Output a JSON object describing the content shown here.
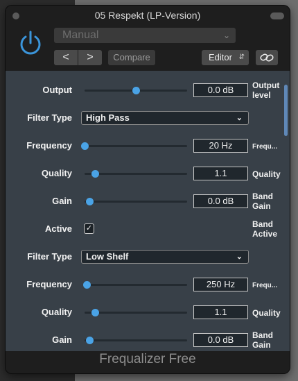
{
  "window": {
    "title": "05 Respekt (LP-Version)"
  },
  "header": {
    "preset": "Manual",
    "nav_prev": "<",
    "nav_next": ">",
    "compare": "Compare",
    "editor": "Editor"
  },
  "colors": {
    "accent": "#4aa3e6",
    "panel": "#384048"
  },
  "rows": [
    {
      "kind": "slider",
      "label": "Output",
      "value": "0.0 dB",
      "unit": "Output level",
      "unit_lines": [
        "Output",
        "level"
      ],
      "level": 0.5
    },
    {
      "kind": "select",
      "label": "Filter Type",
      "value": "High Pass"
    },
    {
      "kind": "slider",
      "label": "Frequency",
      "value": "20 Hz",
      "unit_lines": [
        "Frequ..."
      ],
      "level": 0.0
    },
    {
      "kind": "slider",
      "label": "Quality",
      "value": "1.1",
      "unit_lines": [
        "Quality"
      ],
      "level": 0.1
    },
    {
      "kind": "slider",
      "label": "Gain",
      "value": "0.0 dB",
      "unit_lines": [
        "Band",
        "Gain"
      ],
      "level": 0.05
    },
    {
      "kind": "check",
      "label": "Active",
      "checked": true,
      "unit_lines": [
        "Band",
        "Active"
      ]
    },
    {
      "kind": "select",
      "label": "Filter Type",
      "value": "Low Shelf"
    },
    {
      "kind": "slider",
      "label": "Frequency",
      "value": "250 Hz",
      "unit_lines": [
        "Frequ..."
      ],
      "level": 0.02
    },
    {
      "kind": "slider",
      "label": "Quality",
      "value": "1.1",
      "unit_lines": [
        "Quality"
      ],
      "level": 0.1
    },
    {
      "kind": "slider",
      "label": "Gain",
      "value": "0.0 dB",
      "unit_lines": [
        "Band",
        "Gain"
      ],
      "level": 0.05
    }
  ],
  "footer": {
    "name": "Frequalizer Free"
  }
}
